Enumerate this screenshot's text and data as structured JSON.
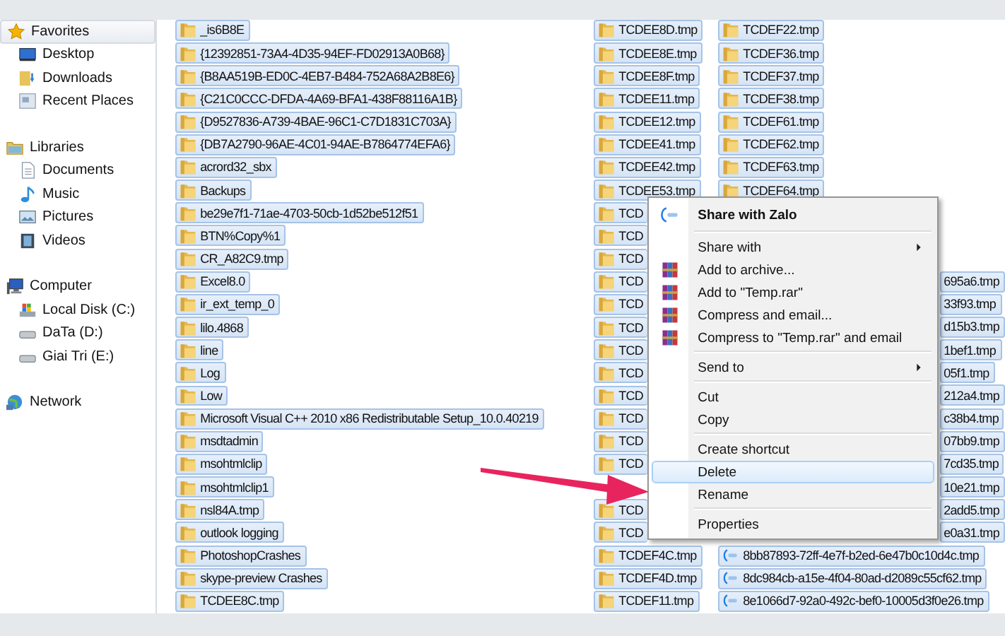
{
  "sidebar": {
    "groups": [
      {
        "label": "Favorites",
        "kind": "favorites",
        "selected": true,
        "items": [
          {
            "label": "Desktop",
            "kind": "desktop",
            "selected": false
          },
          {
            "label": "Downloads",
            "kind": "downloads",
            "selected": false
          },
          {
            "label": "Recent Places",
            "kind": "recent",
            "selected": false
          }
        ]
      },
      {
        "label": "Libraries",
        "kind": "libraries",
        "selected": false,
        "items": [
          {
            "label": "Documents",
            "kind": "documents",
            "selected": false
          },
          {
            "label": "Music",
            "kind": "music",
            "selected": false
          },
          {
            "label": "Pictures",
            "kind": "pictures",
            "selected": false
          },
          {
            "label": "Videos",
            "kind": "videos",
            "selected": false
          }
        ]
      },
      {
        "label": "Computer",
        "kind": "computer",
        "selected": false,
        "items": [
          {
            "label": "Local Disk (C:)",
            "kind": "disk",
            "selected": false
          },
          {
            "label": "DaTa (D:)",
            "kind": "drive",
            "selected": false
          },
          {
            "label": "Giai Tri (E:)",
            "kind": "drive",
            "selected": false
          }
        ]
      },
      {
        "label": "Network",
        "kind": "network",
        "selected": false
      }
    ]
  },
  "files": {
    "columns": [
      [
        {
          "name": "_is6B8E",
          "kind": "folder",
          "selected": true
        },
        {
          "name": "{12392851-73A4-4D35-94EF-FD02913A0B68}",
          "kind": "folder",
          "selected": true
        },
        {
          "name": "{B8AA519B-ED0C-4EB7-B484-752A68A2B8E6}",
          "kind": "folder",
          "selected": true
        },
        {
          "name": "{C21C0CCC-DFDA-4A69-BFA1-438F88116A1B}",
          "kind": "folder",
          "selected": true
        },
        {
          "name": "{D9527836-A739-4BAE-96C1-C7D1831C703A}",
          "kind": "folder",
          "selected": true
        },
        {
          "name": "{DB7A2790-96AE-4C01-94AE-B7864774EFA6}",
          "kind": "folder",
          "selected": true
        },
        {
          "name": "acrord32_sbx",
          "kind": "folder",
          "selected": true
        },
        {
          "name": "Backups",
          "kind": "folder",
          "selected": true
        },
        {
          "name": "be29e7f1-71ae-4703-50cb-1d52be512f51",
          "kind": "folder",
          "selected": true
        },
        {
          "name": "BTN%Copy%1",
          "kind": "folder",
          "selected": true
        },
        {
          "name": "CR_A82C9.tmp",
          "kind": "folder",
          "selected": true
        },
        {
          "name": "Excel8.0",
          "kind": "folder",
          "selected": true
        },
        {
          "name": "ir_ext_temp_0",
          "kind": "folder",
          "selected": true
        },
        {
          "name": "lilo.4868",
          "kind": "folder",
          "selected": true
        },
        {
          "name": "line",
          "kind": "folder",
          "selected": true
        },
        {
          "name": "Log",
          "kind": "folder",
          "selected": true
        },
        {
          "name": "Low",
          "kind": "folder",
          "selected": true
        },
        {
          "name": "Microsoft Visual C++ 2010  x86 Redistributable Setup_10.0.40219",
          "kind": "folder",
          "selected": true
        },
        {
          "name": "msdtadmin",
          "kind": "folder",
          "selected": true
        },
        {
          "name": "msohtmlclip",
          "kind": "folder",
          "selected": true
        },
        {
          "name": "msohtmlclip1",
          "kind": "folder",
          "selected": true
        },
        {
          "name": "nsl84A.tmp",
          "kind": "folder",
          "selected": true
        },
        {
          "name": "outlook logging",
          "kind": "folder",
          "selected": true
        },
        {
          "name": "PhotoshopCrashes",
          "kind": "folder",
          "selected": true
        },
        {
          "name": "skype-preview Crashes",
          "kind": "folder",
          "selected": true
        },
        {
          "name": "TCDEE8C.tmp",
          "kind": "folder",
          "selected": true
        }
      ],
      [
        {
          "name": "TCDEE8D.tmp",
          "kind": "folder",
          "selected": true
        },
        {
          "name": "TCDEE8E.tmp",
          "kind": "folder",
          "selected": true
        },
        {
          "name": "TCDEE8F.tmp",
          "kind": "folder",
          "selected": true
        },
        {
          "name": "TCDEE11.tmp",
          "kind": "folder",
          "selected": true
        },
        {
          "name": "TCDEE12.tmp",
          "kind": "folder",
          "selected": true
        },
        {
          "name": "TCDEE41.tmp",
          "kind": "folder",
          "selected": true
        },
        {
          "name": "TCDEE42.tmp",
          "kind": "folder",
          "selected": true
        },
        {
          "name": "TCDEE53.tmp",
          "kind": "folder",
          "selected": true
        },
        {
          "name": "TCD",
          "kind": "covered",
          "selected": true
        },
        {
          "name": "TCD",
          "kind": "covered",
          "selected": true
        },
        {
          "name": "TCD",
          "kind": "covered",
          "selected": true
        },
        {
          "name": "TCD",
          "kind": "covered",
          "selected": true
        },
        {
          "name": "TCD",
          "kind": "covered",
          "selected": true
        },
        {
          "name": "TCD",
          "kind": "covered",
          "selected": true
        },
        {
          "name": "TCD",
          "kind": "covered",
          "selected": true
        },
        {
          "name": "TCD",
          "kind": "covered",
          "selected": true
        },
        {
          "name": "TCD",
          "kind": "covered",
          "selected": true
        },
        {
          "name": "TCD",
          "kind": "covered",
          "selected": true
        },
        {
          "name": "TCD",
          "kind": "covered",
          "selected": true
        },
        {
          "name": "TCD",
          "kind": "covered",
          "selected": true
        },
        {
          "kind": "hidden"
        },
        {
          "name": "TCD",
          "kind": "covered",
          "selected": true
        },
        {
          "name": "TCD",
          "kind": "covered",
          "selected": true
        },
        {
          "name": "TCDEF4C.tmp",
          "kind": "folder",
          "selected": true
        },
        {
          "name": "TCDEF4D.tmp",
          "kind": "folder",
          "selected": true
        },
        {
          "name": "TCDEF11.tmp",
          "kind": "folder",
          "selected": true
        }
      ],
      [
        {
          "name": "TCDEF22.tmp",
          "kind": "folder",
          "selected": true
        },
        {
          "name": "TCDEF36.tmp",
          "kind": "folder",
          "selected": true
        },
        {
          "name": "TCDEF37.tmp",
          "kind": "folder",
          "selected": true
        },
        {
          "name": "TCDEF38.tmp",
          "kind": "folder",
          "selected": true
        },
        {
          "name": "TCDEF61.tmp",
          "kind": "folder",
          "selected": true
        },
        {
          "name": "TCDEF62.tmp",
          "kind": "folder",
          "selected": true
        },
        {
          "name": "TCDEF63.tmp",
          "kind": "folder",
          "selected": true
        },
        {
          "name": "TCDEF64.tmp",
          "kind": "folder",
          "selected": true
        },
        {
          "kind": "hidden"
        },
        {
          "kind": "hidden"
        },
        {
          "kind": "hidden"
        },
        {
          "name": "695a6.tmp",
          "kind": "tail",
          "selected": true
        },
        {
          "name": "33f93.tmp",
          "kind": "tail",
          "selected": true
        },
        {
          "name": "d15b3.tmp",
          "kind": "tail",
          "selected": true
        },
        {
          "name": "1bef1.tmp",
          "kind": "tail",
          "selected": true
        },
        {
          "name": "05f1.tmp",
          "kind": "tail",
          "selected": true
        },
        {
          "name": "212a4.tmp",
          "kind": "tail",
          "selected": true
        },
        {
          "name": "c38b4.tmp",
          "kind": "tail",
          "selected": true
        },
        {
          "name": "07bb9.tmp",
          "kind": "tail",
          "selected": true
        },
        {
          "name": "7cd35.tmp",
          "kind": "tail",
          "selected": true
        },
        {
          "name": "10e21.tmp",
          "kind": "tail",
          "selected": true
        },
        {
          "name": "2add5.tmp",
          "kind": "tail",
          "selected": true
        },
        {
          "name": "e0a31.tmp",
          "kind": "tail",
          "selected": true
        },
        {
          "name": "8bb87893-72ff-4e7f-b2ed-6e47b0c10d4c.tmp",
          "kind": "zalo",
          "selected": true
        },
        {
          "name": "8dc984cb-a15e-4f04-80ad-d2089c55cf62.tmp",
          "kind": "zalo",
          "selected": true
        },
        {
          "name": "8e1066d7-92a0-492c-bef0-10005d3f0e26.tmp",
          "kind": "zalo",
          "selected": true
        }
      ]
    ]
  },
  "context_menu": {
    "items": [
      {
        "label": "Share with Zalo",
        "kind": "zalo",
        "selected": false
      },
      {
        "kind": "separator"
      },
      {
        "label": "Share with",
        "kind": "submenu",
        "selected": false
      },
      {
        "label": "Add to archive...",
        "kind": "rar",
        "selected": false
      },
      {
        "label": "Add to \"Temp.rar\"",
        "kind": "rar",
        "selected": false
      },
      {
        "label": "Compress and email...",
        "kind": "rar",
        "selected": false
      },
      {
        "label": "Compress to \"Temp.rar\" and email",
        "kind": "rar",
        "selected": false
      },
      {
        "kind": "separator"
      },
      {
        "label": "Send to",
        "kind": "submenu",
        "selected": false
      },
      {
        "kind": "separator"
      },
      {
        "label": "Cut",
        "kind": "plain",
        "selected": false
      },
      {
        "label": "Copy",
        "kind": "plain",
        "selected": false
      },
      {
        "kind": "separator"
      },
      {
        "label": "Create shortcut",
        "kind": "plain",
        "selected": false
      },
      {
        "label": "Delete",
        "kind": "plain",
        "selected": true
      },
      {
        "label": "Rename",
        "kind": "plain",
        "selected": false
      },
      {
        "kind": "separator"
      },
      {
        "label": "Properties",
        "kind": "plain",
        "selected": false
      }
    ]
  }
}
